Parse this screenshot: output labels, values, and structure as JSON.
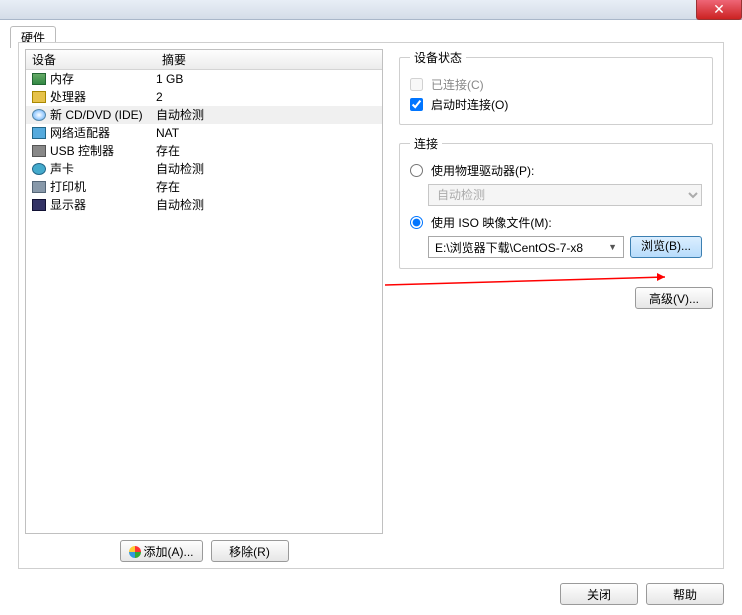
{
  "tab_title": "硬件",
  "headers": {
    "device": "设备",
    "summary": "摘要"
  },
  "devices": [
    {
      "name": "内存",
      "summary": "1 GB",
      "icon": "i-mem"
    },
    {
      "name": "处理器",
      "summary": "2",
      "icon": "i-cpu"
    },
    {
      "name": "新 CD/DVD (IDE)",
      "summary": "自动检测",
      "icon": "i-cd",
      "selected": true
    },
    {
      "name": "网络适配器",
      "summary": "NAT",
      "icon": "i-net"
    },
    {
      "name": "USB 控制器",
      "summary": "存在",
      "icon": "i-usb"
    },
    {
      "name": "声卡",
      "summary": "自动检测",
      "icon": "i-snd"
    },
    {
      "name": "打印机",
      "summary": "存在",
      "icon": "i-prt"
    },
    {
      "name": "显示器",
      "summary": "自动检测",
      "icon": "i-disp"
    }
  ],
  "buttons": {
    "add": "添加(A)...",
    "remove": "移除(R)",
    "browse": "浏览(B)...",
    "advanced": "高级(V)...",
    "close": "关闭",
    "help": "帮助"
  },
  "status_group": {
    "legend": "设备状态",
    "connected": "已连接(C)",
    "connect_on": "启动时连接(O)"
  },
  "conn_group": {
    "legend": "连接",
    "physical": "使用物理驱动器(P):",
    "physical_select": "自动检测",
    "iso": "使用 ISO 映像文件(M):",
    "iso_path": "E:\\浏览器下载\\CentOS-7-x8"
  }
}
